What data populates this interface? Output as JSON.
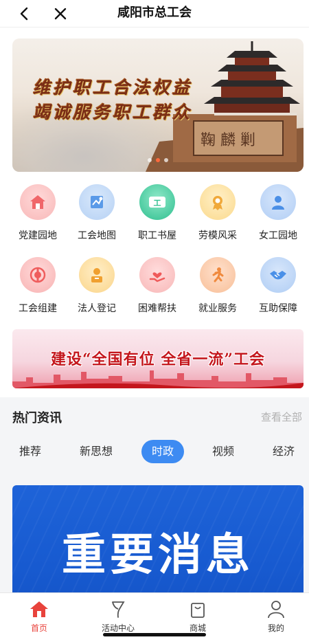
{
  "header": {
    "title": "咸阳市总工会"
  },
  "banner": {
    "line1": "维护职工合法权益",
    "line2": "竭诚服务职工群众",
    "slide_count": 3,
    "active_slide": 1
  },
  "grid": {
    "items": [
      {
        "label": "党建园地",
        "icon": "party-building-icon",
        "color": "#f0676a"
      },
      {
        "label": "工会地图",
        "icon": "map-icon",
        "color": "#5a9ae8"
      },
      {
        "label": "职工书屋",
        "icon": "bookstore-icon",
        "color": "#2fbf8f"
      },
      {
        "label": "劳模风采",
        "icon": "medal-icon",
        "color": "#f0a93a"
      },
      {
        "label": "女工园地",
        "icon": "woman-icon",
        "color": "#4b8fe6"
      },
      {
        "label": "工会组建",
        "icon": "union-emblem-icon",
        "color": "#ef5d5d"
      },
      {
        "label": "法人登记",
        "icon": "registration-icon",
        "color": "#f0a030"
      },
      {
        "label": "困难帮扶",
        "icon": "helping-hand-icon",
        "color": "#ef5a5a"
      },
      {
        "label": "就业服务",
        "icon": "running-person-icon",
        "color": "#f08a3e"
      },
      {
        "label": "互助保障",
        "icon": "handshake-icon",
        "color": "#4a90e8"
      }
    ]
  },
  "banner2": {
    "text": "建设“全国有位 全省一流”工会"
  },
  "news": {
    "title": "热门资讯",
    "more": "查看全部",
    "tabs": [
      {
        "label": "推荐",
        "active": false
      },
      {
        "label": "新思想",
        "active": false
      },
      {
        "label": "时政",
        "active": true
      },
      {
        "label": "视频",
        "active": false
      },
      {
        "label": "经济",
        "active": false
      }
    ],
    "card_title": "重要消息"
  },
  "tabbar": {
    "items": [
      {
        "label": "首页",
        "icon": "home-icon",
        "active": true
      },
      {
        "label": "活动中心",
        "icon": "activity-icon",
        "active": false
      },
      {
        "label": "商城",
        "icon": "shopping-bag-icon",
        "active": false
      },
      {
        "label": "我的",
        "icon": "profile-icon",
        "active": false
      }
    ]
  },
  "colors": {
    "accent": "#3d8bf2",
    "brand_red": "#e8433c"
  }
}
